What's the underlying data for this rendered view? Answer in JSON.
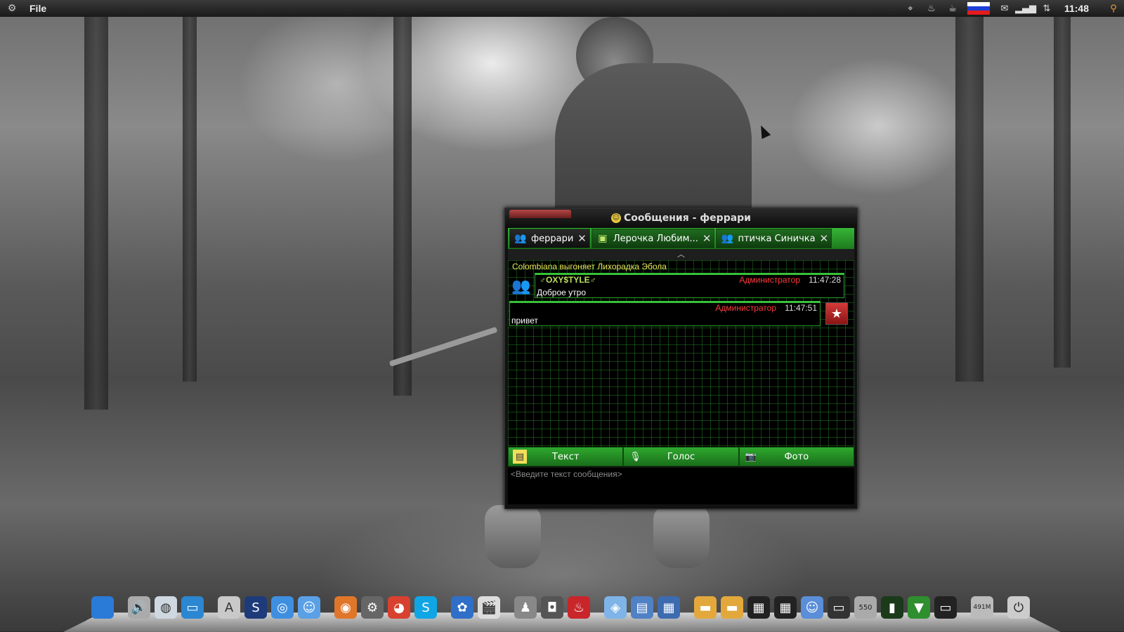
{
  "top_panel": {
    "menu_label": "File",
    "clock": "11:48",
    "flag_colors": [
      "#ffffff",
      "#1c3fd6",
      "#e41b1b"
    ],
    "tray_icons": [
      "location-icon",
      "steam-icon",
      "coffee-icon",
      "mail-icon",
      "signal-icon",
      "network-icon"
    ]
  },
  "chat": {
    "title": "Сообщения - феррари",
    "tabs": [
      {
        "label": "феррари",
        "active": true
      },
      {
        "label": "Лерочка Любим...",
        "active": false
      },
      {
        "label": "птичка Синичка",
        "active": false
      }
    ],
    "system_message": "Colombiana выгоняет Лихорадка Эбола",
    "messages": [
      {
        "nick": "♂OXY$TYLE♂",
        "role": "Администратор",
        "time": "11:47:28",
        "text": "Доброе утро"
      },
      {
        "role": "Администратор",
        "time": "11:47:51",
        "text": "привет"
      }
    ],
    "modes": [
      "Текст",
      "Голос",
      "Фото"
    ],
    "input_placeholder": "<Введите текст сообщения>"
  },
  "dock": {
    "items": [
      "apple-icon",
      "volume-icon",
      "globe-icon",
      "monitor-icon",
      "app-store-icon",
      "skype-s-icon",
      "safari-icon",
      "finder-icon",
      "firefox-icon",
      "settings-icon",
      "chrome-icon",
      "skype-icon",
      "butterfly-icon",
      "clapper-icon",
      "games-icon",
      "camera-icon",
      "flame-icon",
      "box-icon",
      "window-icon",
      "windows-icon",
      "folder-icon",
      "folder2-icon",
      "display-icon",
      "display2-icon",
      "finder2-icon",
      "terminal-icon",
      "disk-icon",
      "meter-icon",
      "cpu-icon",
      "monitor2-icon",
      "trash-icon",
      "power-icon"
    ],
    "disk_label": "550",
    "mem_label": "491M"
  }
}
